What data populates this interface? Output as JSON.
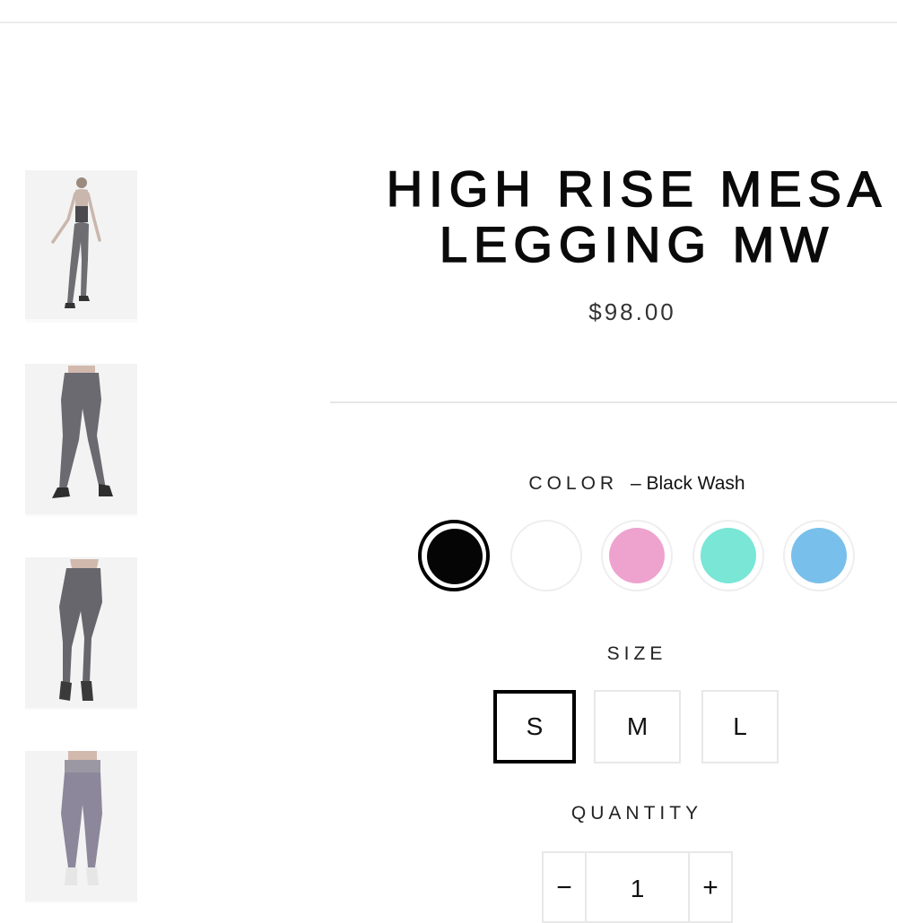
{
  "product": {
    "title_line1": "HIGH RISE MESA",
    "title_line2": "LEGGING MW",
    "price": "$98.00"
  },
  "gallery": {
    "thumbnails": [
      {
        "name": "full-body-front-view"
      },
      {
        "name": "legs-front-view"
      },
      {
        "name": "legs-side-view"
      },
      {
        "name": "legs-back-view"
      }
    ]
  },
  "color": {
    "label": "COLOR",
    "separator": "–",
    "selected": "Black Wash",
    "options": [
      {
        "color": "#050505"
      },
      {
        "color": "#ffffff"
      },
      {
        "color": "#eea3cf"
      },
      {
        "color": "#79e6d6"
      },
      {
        "color": "#79bfeb"
      }
    ]
  },
  "size": {
    "label": "SIZE",
    "options": [
      "S",
      "M",
      "L"
    ],
    "selected": "S"
  },
  "quantity": {
    "label": "QUANTITY",
    "value": "1",
    "decrement": "−",
    "increment": "+"
  }
}
